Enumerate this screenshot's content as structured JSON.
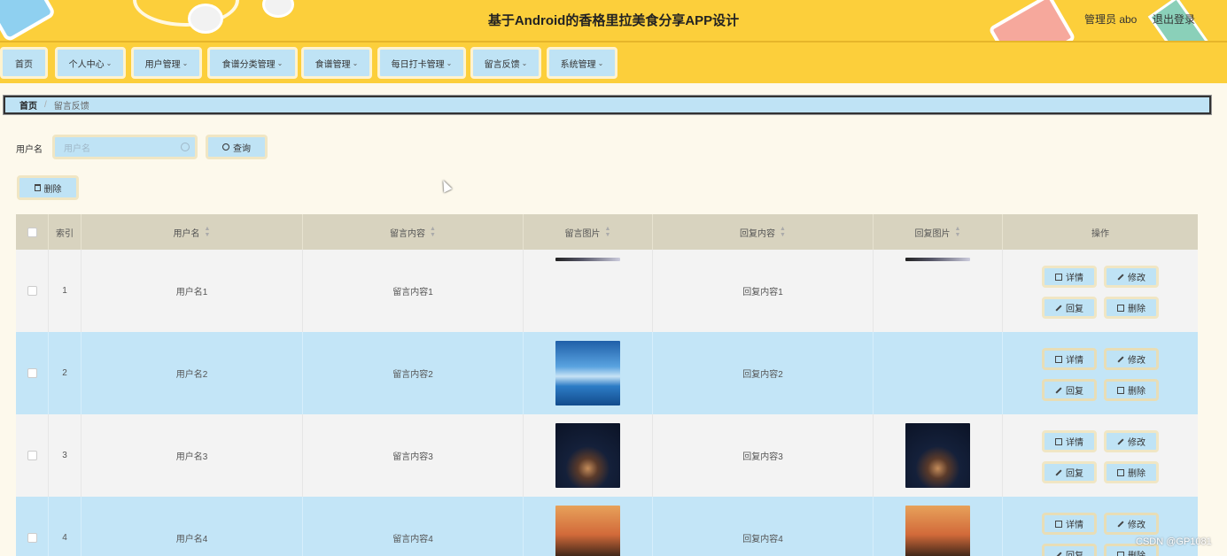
{
  "header": {
    "title": "基于Android的香格里拉美食分享APP设计",
    "user_label": "管理员 abo",
    "logout_label": "退出登录"
  },
  "nav": {
    "items": [
      {
        "label": "首页",
        "has_dropdown": false
      },
      {
        "label": "个人中心",
        "has_dropdown": true
      },
      {
        "label": "用户管理",
        "has_dropdown": true
      },
      {
        "label": "食谱分类管理",
        "has_dropdown": true
      },
      {
        "label": "食谱管理",
        "has_dropdown": true
      },
      {
        "label": "每日打卡管理",
        "has_dropdown": true
      },
      {
        "label": "留言反馈",
        "has_dropdown": true
      },
      {
        "label": "系统管理",
        "has_dropdown": true
      }
    ]
  },
  "breadcrumb": {
    "home": "首页",
    "separator": "/",
    "current": "留言反馈"
  },
  "search": {
    "label": "用户名",
    "placeholder": "用户名",
    "button_label": "查询"
  },
  "toolbar": {
    "delete_label": "删除"
  },
  "table": {
    "headers": [
      "索引",
      "用户名",
      "留言内容",
      "留言图片",
      "回复内容",
      "回复图片",
      "操作"
    ],
    "actions": [
      "详情",
      "修改",
      "回复",
      "删除"
    ],
    "rows": [
      {
        "index": "1",
        "username": "用户名1",
        "message": "留言内容1",
        "message_image": "partial",
        "reply": "回复内容1",
        "reply_image": "partial"
      },
      {
        "index": "2",
        "username": "用户名2",
        "message": "留言内容2",
        "message_image": "lake",
        "reply": "回复内容2",
        "reply_image": "none"
      },
      {
        "index": "3",
        "username": "用户名3",
        "message": "留言内容3",
        "message_image": "night",
        "reply": "回复内容3",
        "reply_image": "night"
      },
      {
        "index": "4",
        "username": "用户名4",
        "message": "留言内容4",
        "message_image": "sunset",
        "reply": "回复内容4",
        "reply_image": "sunset"
      }
    ]
  },
  "watermark": "CSDN @GP1081",
  "colors": {
    "header_bg": "#fccf3b",
    "button_bg": "#bfe3f5",
    "row_alt": "#c3e5f7",
    "thead_bg": "#d8d3bf",
    "page_bg": "#fdf9ec"
  }
}
